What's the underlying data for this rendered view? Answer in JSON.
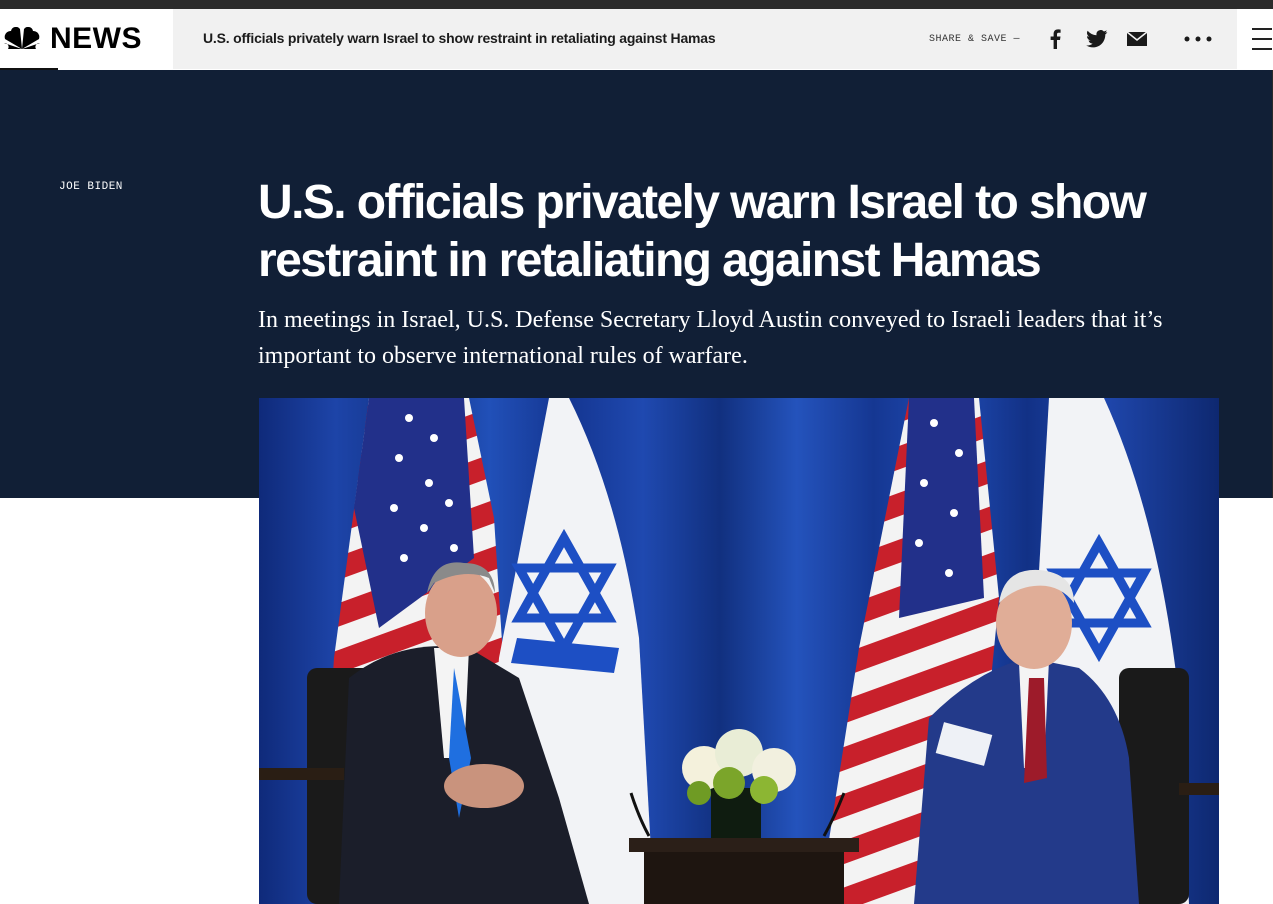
{
  "header": {
    "brand": "NEWS",
    "article_title": "U.S. officials privately warn Israel to show restraint in retaliating against Hamas",
    "share_label": "SHARE & SAVE —",
    "icons": [
      "peacock-logo-icon",
      "facebook-icon",
      "twitter-icon",
      "email-icon",
      "more-icon",
      "menu-icon"
    ]
  },
  "article": {
    "eyebrow": "JOE BIDEN",
    "headline": "U.S. officials privately warn Israel to show restraint in retaliating against Hamas",
    "dek": "In meetings in Israel, U.S. Defense Secretary Lloyd Austin conveyed to Israeli leaders that it’s important to observe international rules of warfare."
  },
  "colors": {
    "hero_background": "#111f36",
    "header_strip": "#f1f1f1",
    "curtain_blue": "#1b3fa0",
    "israel_blue": "#1d4fc4"
  }
}
